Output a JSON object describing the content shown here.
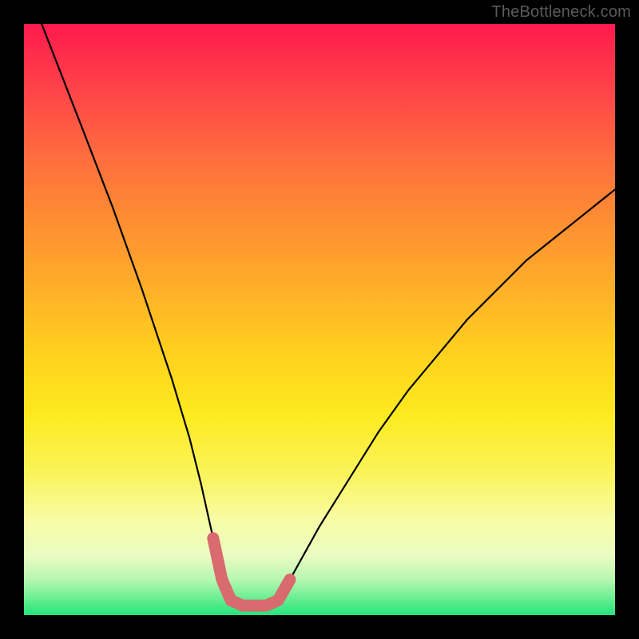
{
  "watermark": "TheBottleneck.com",
  "colors": {
    "background": "#000000",
    "curve_thin": "#000000",
    "curve_thick": "#d96a6e"
  },
  "chart_data": {
    "type": "line",
    "title": "",
    "xlabel": "",
    "ylabel": "",
    "xlim": [
      0,
      100
    ],
    "ylim": [
      0,
      100
    ],
    "grid": false,
    "series": [
      {
        "name": "bottleneck-curve",
        "x": [
          3,
          10,
          15,
          20,
          25,
          28,
          30,
          32,
          33.5,
          35,
          37,
          39,
          41,
          43,
          45,
          50,
          55,
          60,
          65,
          70,
          75,
          80,
          85,
          90,
          95,
          100
        ],
        "values": [
          100,
          82,
          69,
          55,
          40,
          30,
          22,
          13,
          6,
          2.5,
          1.6,
          1.6,
          1.6,
          2.5,
          6,
          15,
          23,
          31,
          38,
          44,
          50,
          55,
          60,
          64,
          68,
          72
        ]
      }
    ],
    "annotations": [
      {
        "name": "thick-bottom-overlay",
        "x": [
          32,
          33.5,
          35,
          37,
          39,
          41,
          43,
          45
        ],
        "values": [
          13,
          6,
          2.5,
          1.6,
          1.6,
          1.6,
          2.5,
          6
        ]
      }
    ]
  }
}
